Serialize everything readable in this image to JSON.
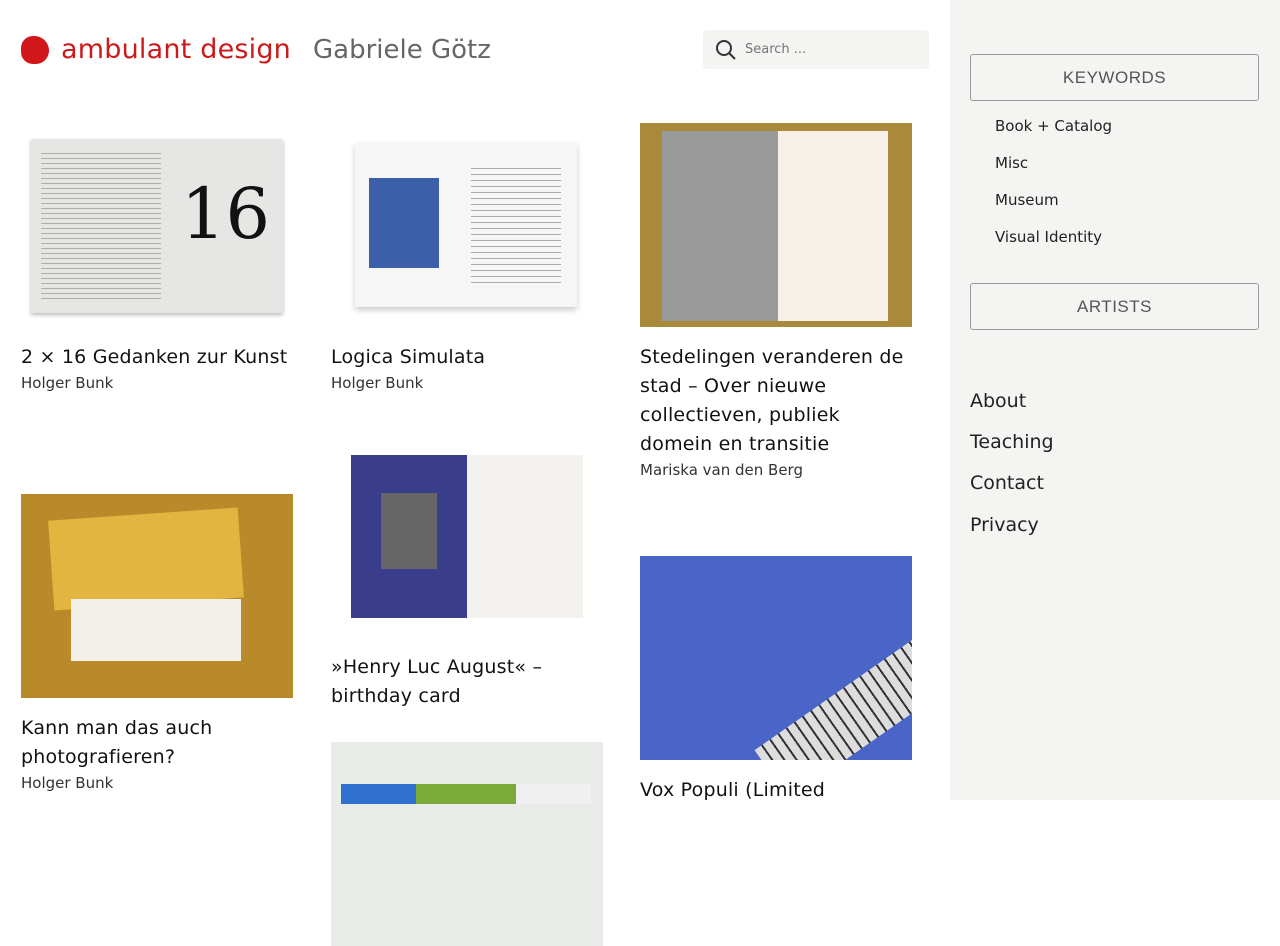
{
  "header": {
    "brand": "ambulant design",
    "person": "Gabriele Götz",
    "search_placeholder": "Search ..."
  },
  "colors": {
    "accent": "#cc1a1a",
    "sidebar_bg": "#f4f4f2"
  },
  "sidebar": {
    "keywords_label": "KEYWORDS",
    "keywords": [
      "Book + Catalog",
      "Misc",
      "Museum",
      "Visual Identity"
    ],
    "artists_label": "ARTISTS",
    "nav": [
      "About",
      "Teaching",
      "Contact",
      "Privacy"
    ]
  },
  "cards": [
    {
      "title": "2 × 16 Gedanken zur Kunst",
      "author": "Holger Bunk"
    },
    {
      "title": "Kann man das auch photografieren?",
      "author": "Holger Bunk"
    },
    {
      "title": "Logica Simulata",
      "author": "Holger Bunk"
    },
    {
      "title": "»Henry Luc August« – birthday card",
      "author": ""
    },
    {
      "title": "",
      "author": ""
    },
    {
      "title": "Stedelingen veranderen de stad – Over nieuwe collectieven, publiek domein en transitie",
      "author": "Mariska van den Berg"
    },
    {
      "title": "Vox Populi (Limited",
      "author": ""
    }
  ]
}
